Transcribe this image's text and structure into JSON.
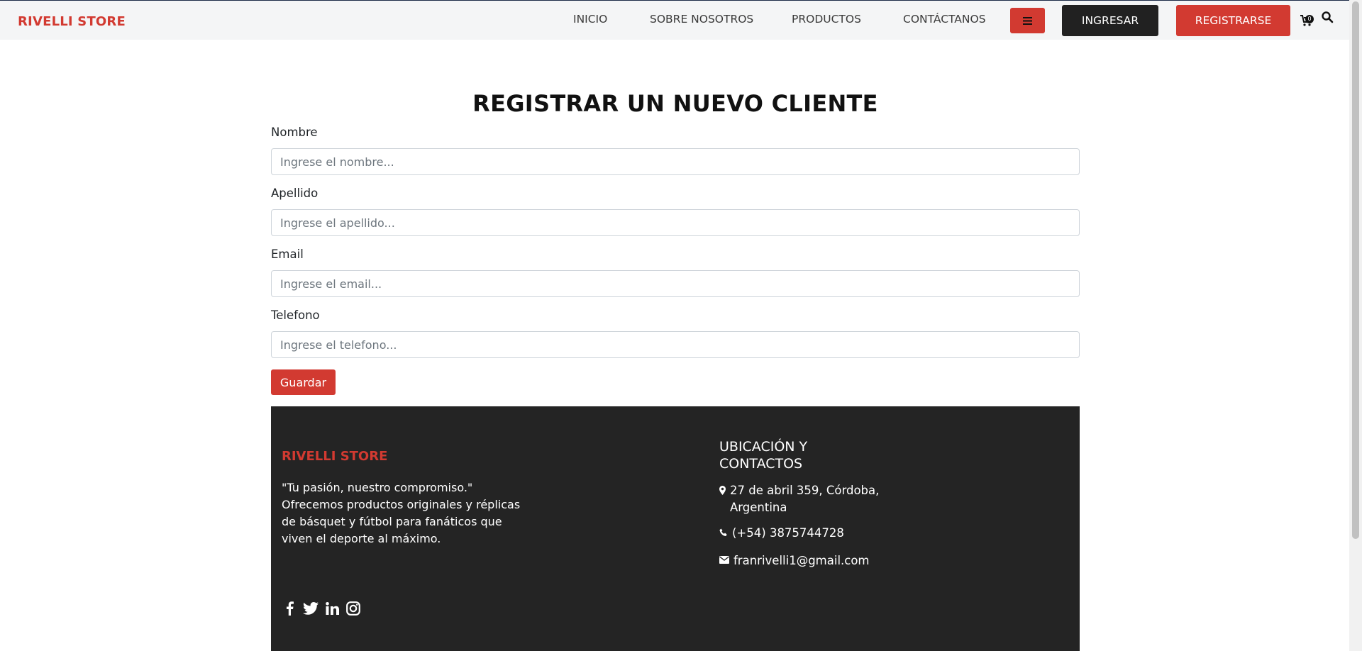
{
  "header": {
    "brand": "RIVELLI STORE",
    "nav": {
      "inicio": "INICIO",
      "sobre": "SOBRE NOSOTROS",
      "productos": "PRODUCTOS",
      "contactanos": "CONTÁCTANOS"
    },
    "login_label": "INGRESAR",
    "register_label": "REGISTRARSE",
    "cart_count": "0",
    "icons": [
      "menu-icon",
      "cart-icon",
      "search-icon"
    ]
  },
  "form": {
    "title": "REGISTRAR UN NUEVO CLIENTE",
    "fields": {
      "nombre": {
        "label": "Nombre",
        "placeholder": "Ingrese el nombre...",
        "value": ""
      },
      "apellido": {
        "label": "Apellido",
        "placeholder": "Ingrese el apellido...",
        "value": ""
      },
      "email": {
        "label": "Email",
        "placeholder": "Ingrese el email...",
        "value": ""
      },
      "telefono": {
        "label": "Telefono",
        "placeholder": "Ingrese el telefono...",
        "value": ""
      }
    },
    "submit_label": "Guardar"
  },
  "footer": {
    "brand": "RIVELLI STORE",
    "tagline": "\"Tu pasión, nuestro compromiso.\"",
    "description": "Ofrecemos productos originales y réplicas de básquet y fútbol para fanáticos que viven el deporte al máximo.",
    "contact_heading": "UBICACIÓN Y CONTACTOS",
    "address": "27 de abril 359, Córdoba, Argentina",
    "phone": "(+54) 3875744728",
    "email": "franrivelli1@gmail.com",
    "social_icons": [
      "facebook-icon",
      "twitter-icon",
      "linkedin-icon",
      "instagram-icon"
    ]
  },
  "colors": {
    "accent": "#d23a31",
    "dark": "#212121",
    "footer_bg": "#242424",
    "navbar_bg": "#f4f5f6"
  }
}
